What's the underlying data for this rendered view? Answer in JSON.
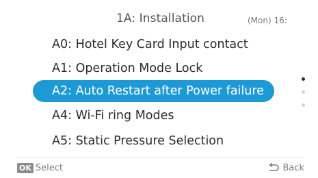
{
  "header": {
    "title": "1A: Installation",
    "clock": "(Mon) 16:"
  },
  "menu": {
    "items": [
      {
        "label": "A0: Hotel Key Card Input contact",
        "selected": false
      },
      {
        "label": "A1: Operation Mode Lock",
        "selected": false
      },
      {
        "label": "A2: Auto Restart after Power failure",
        "selected": true
      },
      {
        "label": "A4: Wi-Fi       ring Modes",
        "selected": false
      },
      {
        "label": "A5: Static Pressure Selection",
        "selected": false
      }
    ]
  },
  "scroll": {
    "page_count": 3,
    "active_page": 1
  },
  "footer": {
    "ok_badge": "OK",
    "select_label": "Select",
    "back_label": "Back"
  },
  "colors": {
    "highlight": "#1d9ad6",
    "text": "#2b2b2b",
    "muted": "#7d7d7d"
  }
}
